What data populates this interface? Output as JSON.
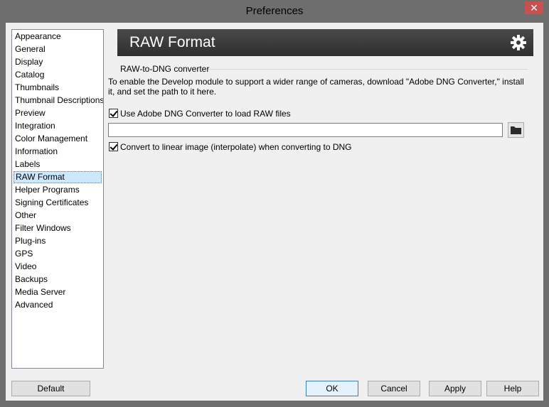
{
  "window": {
    "title": "Preferences",
    "close_glyph": "✕"
  },
  "sidebar": {
    "items": [
      {
        "label": "Appearance"
      },
      {
        "label": "General"
      },
      {
        "label": "Display"
      },
      {
        "label": "Catalog"
      },
      {
        "label": "Thumbnails"
      },
      {
        "label": "Thumbnail Descriptions"
      },
      {
        "label": "Preview"
      },
      {
        "label": "Integration"
      },
      {
        "label": "Color Management"
      },
      {
        "label": "Information"
      },
      {
        "label": "Labels"
      },
      {
        "label": "RAW Format",
        "selected": true
      },
      {
        "label": "Helper Programs"
      },
      {
        "label": "Signing Certificates"
      },
      {
        "label": "Other"
      },
      {
        "label": "Filter Windows"
      },
      {
        "label": "Plug-ins"
      },
      {
        "label": "GPS"
      },
      {
        "label": "Video"
      },
      {
        "label": "Backups"
      },
      {
        "label": "Media Server"
      },
      {
        "label": "Advanced"
      }
    ]
  },
  "panel": {
    "title": "RAW Format",
    "header_icon": "gear-icon",
    "group_label": "RAW-to-DNG converter",
    "description": "To enable the Develop module to support a wider range of cameras, download \"Adobe DNG Converter,\" install it, and set the path to it here.",
    "use_converter_label": "Use Adobe DNG Converter to load RAW files",
    "use_converter_checked": true,
    "path_value": "",
    "browse_icon": "folder-icon",
    "linear_label": "Convert to linear image (interpolate) when converting to DNG",
    "linear_checked": true
  },
  "buttons": {
    "default_label": "Default",
    "ok_label": "OK",
    "cancel_label": "Cancel",
    "apply_label": "Apply",
    "help_label": "Help"
  }
}
